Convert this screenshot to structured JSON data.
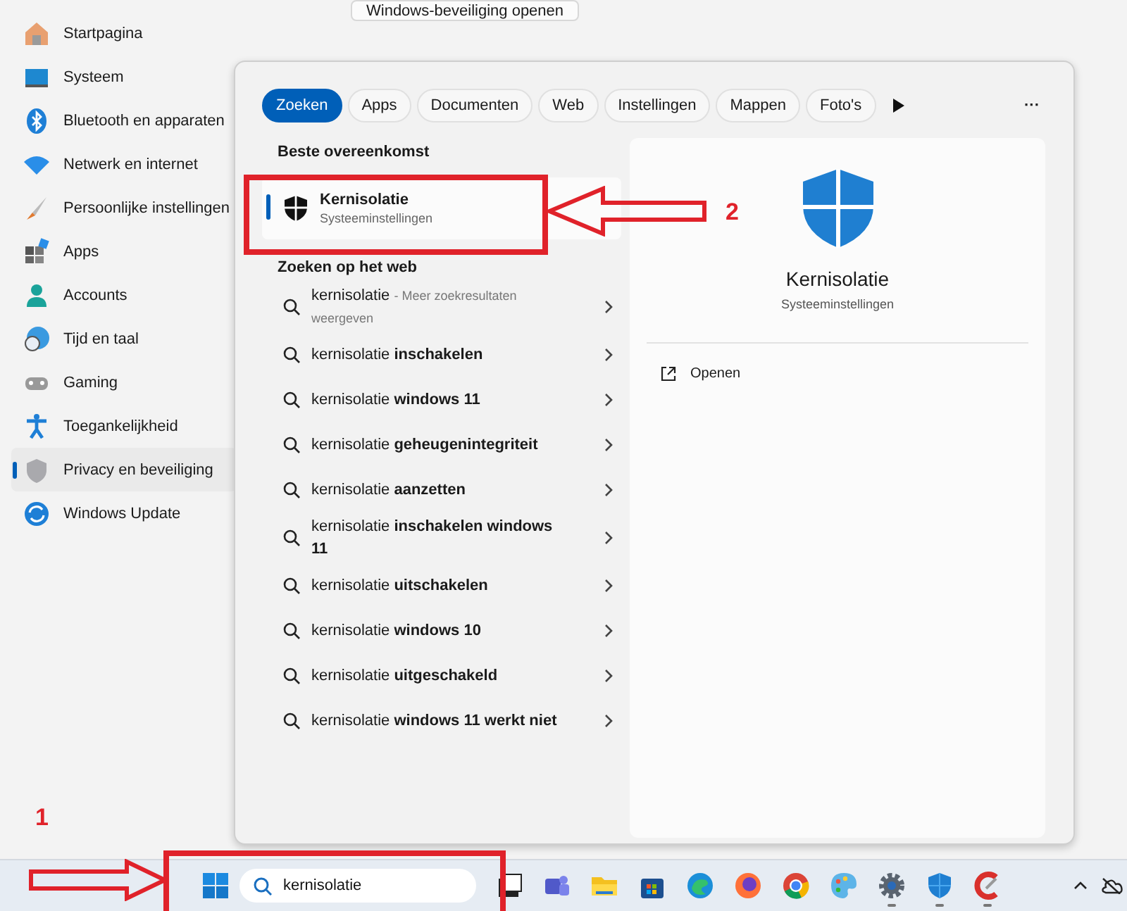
{
  "settings": {
    "top_button": "Windows-beveiliging openen",
    "sidebar": {
      "items": [
        {
          "label": "Startpagina",
          "selected": false
        },
        {
          "label": "Systeem",
          "selected": false
        },
        {
          "label": "Bluetooth en apparaten",
          "selected": false
        },
        {
          "label": "Netwerk en internet",
          "selected": false
        },
        {
          "label": "Persoonlijke instellingen",
          "selected": false
        },
        {
          "label": "Apps",
          "selected": false
        },
        {
          "label": "Accounts",
          "selected": false
        },
        {
          "label": "Tijd en taal",
          "selected": false
        },
        {
          "label": "Gaming",
          "selected": false
        },
        {
          "label": "Toegankelijkheid",
          "selected": false
        },
        {
          "label": "Privacy en beveiliging",
          "selected": true
        },
        {
          "label": "Windows Update",
          "selected": false
        }
      ]
    }
  },
  "search_panel": {
    "tabs": [
      {
        "label": "Zoeken",
        "selected": true
      },
      {
        "label": "Apps",
        "selected": false
      },
      {
        "label": "Documenten",
        "selected": false
      },
      {
        "label": "Web",
        "selected": false
      },
      {
        "label": "Instellingen",
        "selected": false
      },
      {
        "label": "Mappen",
        "selected": false
      },
      {
        "label": "Foto's",
        "selected": false
      }
    ],
    "more_button": "···",
    "best_match": {
      "heading": "Beste overeenkomst",
      "title": "Kernisolatie",
      "subtitle": "Systeeminstellingen",
      "selected": true
    },
    "web": {
      "heading": "Zoeken op het web",
      "results": [
        {
          "text": "kernisolatie",
          "note": "- Meer zoekresultaten weergeven"
        },
        {
          "text": "kernisolatie **inschakelen**"
        },
        {
          "text": "kernisolatie **windows 11**"
        },
        {
          "text": "kernisolatie **geheugenintegriteit**"
        },
        {
          "text": "kernisolatie **aanzetten**"
        },
        {
          "text": "kernisolatie **inschakelen windows 11**"
        },
        {
          "text": "kernisolatie **uitschakelen**"
        },
        {
          "text": "kernisolatie **windows 10**"
        },
        {
          "text": "kernisolatie **uitgeschakeld**"
        },
        {
          "text": "kernisolatie **windows 11 werkt niet**"
        }
      ]
    },
    "preview": {
      "title": "Kernisolatie",
      "subtitle": "Systeeminstellingen",
      "actions": [
        {
          "label": "Openen"
        }
      ]
    }
  },
  "taskbar": {
    "search": {
      "value": "kernisolatie"
    },
    "apps": [
      {
        "running": false
      },
      {
        "running": false
      },
      {
        "running": false
      },
      {
        "running": false
      },
      {
        "running": false
      },
      {
        "running": false
      },
      {
        "running": false
      },
      {
        "running": false
      },
      {
        "running": true
      },
      {
        "running": true
      },
      {
        "running": true
      }
    ]
  },
  "annotations": [
    {
      "label": "1"
    },
    {
      "label": "2"
    }
  ]
}
